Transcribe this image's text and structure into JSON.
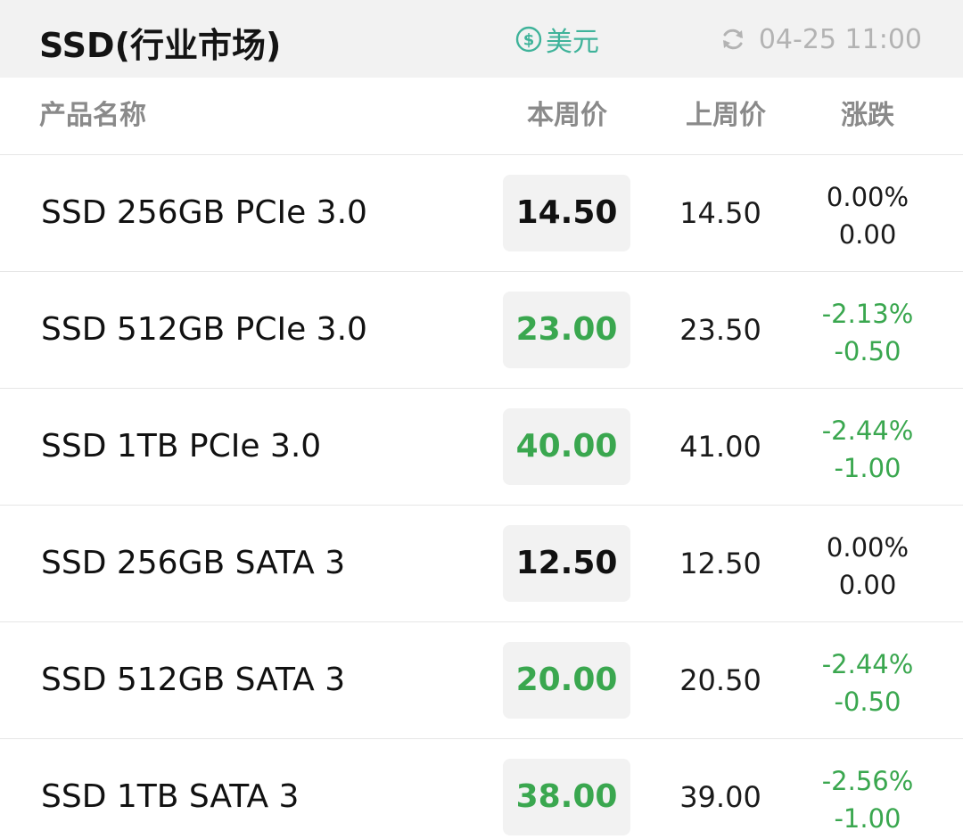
{
  "header": {
    "title": "SSD(行业市场)",
    "currency_label": "美元",
    "currency_icon": "dollar-circle-icon",
    "refresh_icon": "refresh-icon",
    "updated_time": "04-25 11:00"
  },
  "colors": {
    "accent_teal": "#3fb39a",
    "down_green": "#3aa74f",
    "header_bg": "#f2f2f2"
  },
  "table": {
    "columns": {
      "name": "产品名称",
      "current": "本周价",
      "previous": "上周价",
      "change": "涨跌"
    },
    "rows": [
      {
        "name": "SSD 256GB PCIe 3.0",
        "current": "14.50",
        "previous": "14.50",
        "pct": "0.00%",
        "diff": "0.00",
        "trend": "flat"
      },
      {
        "name": "SSD 512GB PCIe 3.0",
        "current": "23.00",
        "previous": "23.50",
        "pct": "-2.13%",
        "diff": "-0.50",
        "trend": "down"
      },
      {
        "name": "SSD 1TB PCIe 3.0",
        "current": "40.00",
        "previous": "41.00",
        "pct": "-2.44%",
        "diff": "-1.00",
        "trend": "down"
      },
      {
        "name": "SSD 256GB SATA 3",
        "current": "12.50",
        "previous": "12.50",
        "pct": "0.00%",
        "diff": "0.00",
        "trend": "flat"
      },
      {
        "name": "SSD 512GB SATA 3",
        "current": "20.00",
        "previous": "20.50",
        "pct": "-2.44%",
        "diff": "-0.50",
        "trend": "down"
      },
      {
        "name": "SSD 1TB SATA 3",
        "current": "38.00",
        "previous": "39.00",
        "pct": "-2.56%",
        "diff": "-1.00",
        "trend": "down"
      }
    ]
  }
}
